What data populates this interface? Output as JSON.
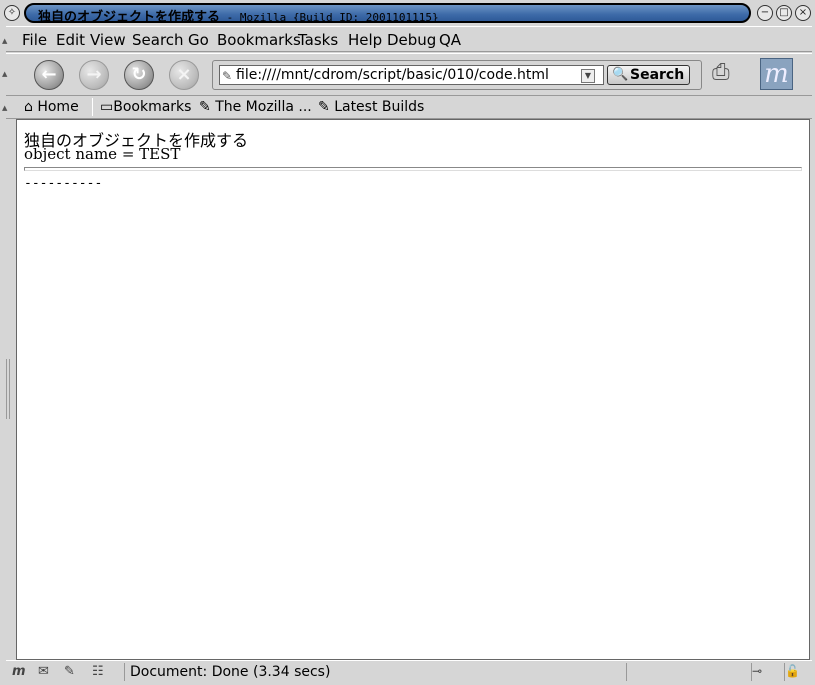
{
  "window": {
    "title_jp": "独自のオブジェクトを作成する",
    "title_suffix": " - Mozilla {Build ID: 2001101115}"
  },
  "menubar": {
    "items": [
      "File",
      "Edit",
      "View",
      "Search",
      "Go",
      "Bookmarks",
      "Tasks",
      "Help",
      "Debug",
      "QA"
    ]
  },
  "navbar": {
    "url": "file:////mnt/cdrom/script/basic/010/code.html",
    "search_label": "Search"
  },
  "personal_toolbar": {
    "home": "Home",
    "bookmarks": "Bookmarks",
    "mozilla": "The Mozilla ...",
    "latest_builds": "Latest Builds"
  },
  "page": {
    "heading": "独自のオブジェクトを作成する",
    "line": "object name = TEST",
    "dashes": "----------"
  },
  "status": {
    "text": "Document: Done (3.34 secs)"
  },
  "icons": {
    "back": "back-arrow-icon",
    "forward": "forward-arrow-icon",
    "reload": "reload-icon",
    "stop": "stop-icon",
    "print": "print-icon",
    "throbber": "mozilla-throbber-icon"
  }
}
